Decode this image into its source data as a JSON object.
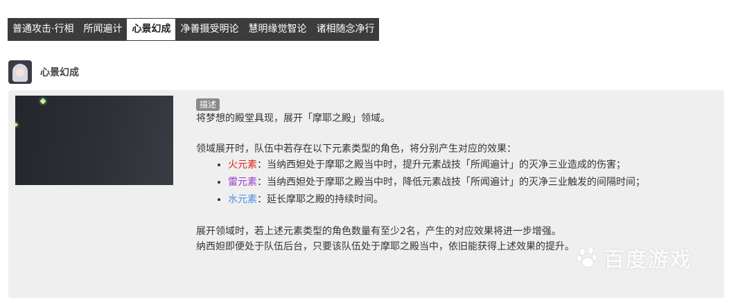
{
  "tabs": [
    {
      "label": "普通攻击·行相"
    },
    {
      "label": "所闻遍计"
    },
    {
      "label": "心景幻成"
    },
    {
      "label": "净善摄受明论"
    },
    {
      "label": "慧明缘觉智论"
    },
    {
      "label": "诸相随念净行"
    }
  ],
  "active_tab_index": 2,
  "skill": {
    "name": "心景幻成"
  },
  "description": {
    "tag": "描述",
    "intro": "将梦想的殿堂具现，展开「摩耶之殿」领域。",
    "effects_intro": "领域展开时，队伍中若存在以下元素类型的角色，将分别产生对应的效果：",
    "effects": [
      {
        "element": "火元素",
        "text": "：当纳西妲处于摩耶之殿当中时，提升元素战技「所闻遍计」的灭净三业造成的伤害；",
        "color": "#e0261d"
      },
      {
        "element": "雷元素",
        "text": "：当纳西妲处于摩耶之殿当中时，降低元素战技「所闻遍计」的灭净三业触发的间隔时间；",
        "color": "#9a3fcf"
      },
      {
        "element": "水元素",
        "text": "：延长摩耶之殿的持续时间。",
        "color": "#4a8fe0"
      }
    ],
    "extra_1": "展开领域时，若上述元素类型的角色数量有至少2名，产生的对应效果将进一步增强。",
    "extra_2": "纳西妲即便处于队伍后台，只要该队伍处于摩耶之殿当中，依旧能获得上述效果的提升。"
  },
  "watermark": {
    "text": "百度游戏"
  }
}
